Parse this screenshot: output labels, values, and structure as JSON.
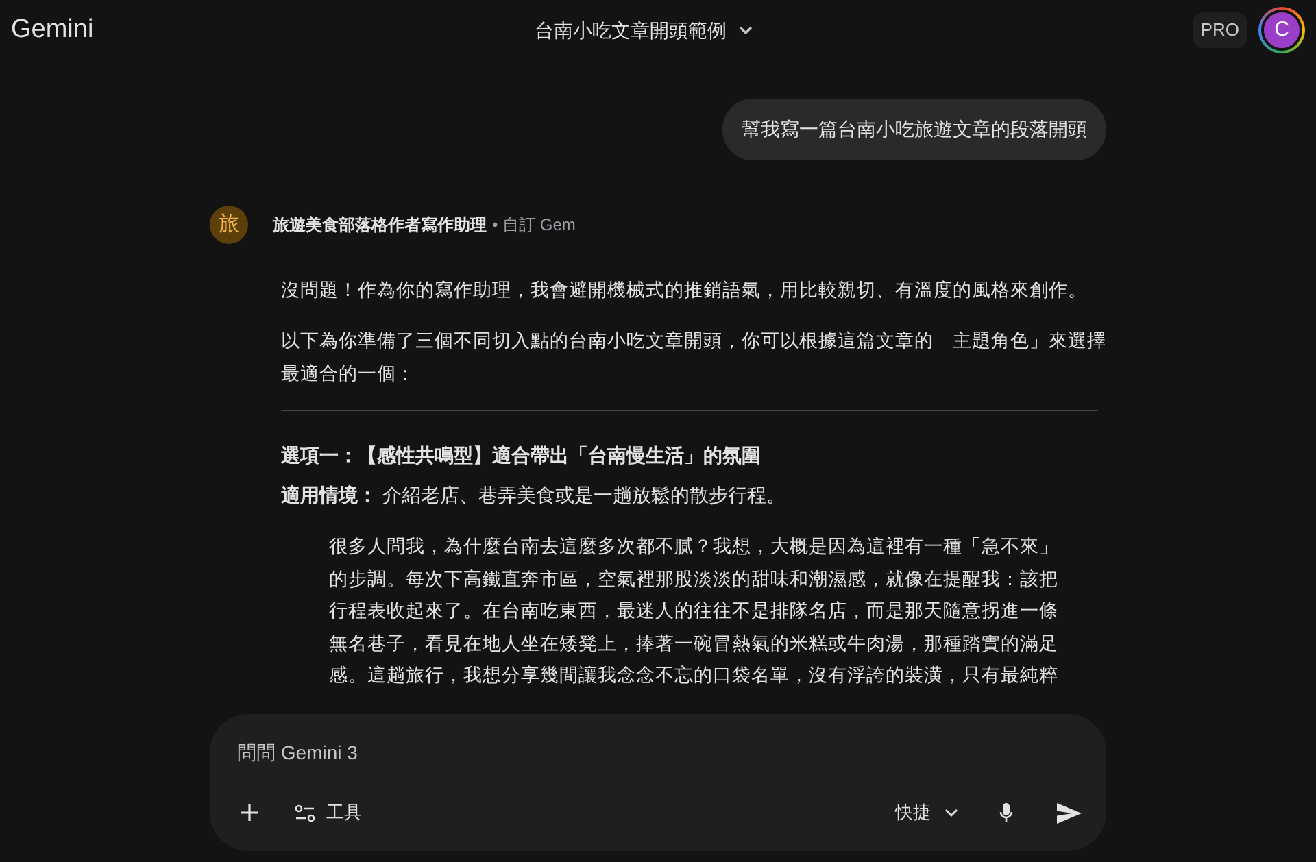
{
  "header": {
    "logo": "Gemini",
    "title": "台南小吃文章開頭範例",
    "badge": "PRO",
    "avatar": "C"
  },
  "user_message": "幫我寫一篇台南小吃旅遊文章的段落開頭",
  "response": {
    "avatar": "旅",
    "author": "旅遊美食部落格作者寫作助理",
    "author_note": "• 自訂 Gem",
    "paragraphs": [
      [
        "沒問題！作為你的寫作助理，我會避開機械式的推銷語氣，用比較親切、有溫度的風格來創作。"
      ],
      [
        "以下為你準備了三個不同切入點的台南小吃文章開頭，你可以根據這篇文章的「主題角色」來選擇",
        "最適合的一個："
      ]
    ],
    "option_title": "選項一：【感性共鳴型】適合帶出「台南慢生活」的氛圍",
    "option_context": "**適用情境：** 介紹老店、巷弄美食或是一趟放鬆的散步行程。",
    "quote": [
      "很多人問我，為什麼台南去這麼多次都不膩？我想，大概是因為這裡有一種「急不來」",
      "的步調。每次下高鐵直奔市區，空氣裡那股淡淡的甜味和潮濕感，就像在提醒我：該把",
      "行程表收起來了。在台南吃東西，最迷人的往往不是排隊名店，而是那天隨意拐進一條",
      "無名巷子，看見在地人坐在矮凳上，捧著一碗冒熱氣的米糕或牛肉湯，那種踏實的滿足",
      "感。這趟旅行，我想分享幾間讓我念念不忘的口袋名單，沒有浮誇的裝潢，只有最純粹"
    ]
  },
  "composer": {
    "placeholder": "問問 Gemini 3",
    "tools": "工具",
    "mode": "快捷"
  }
}
